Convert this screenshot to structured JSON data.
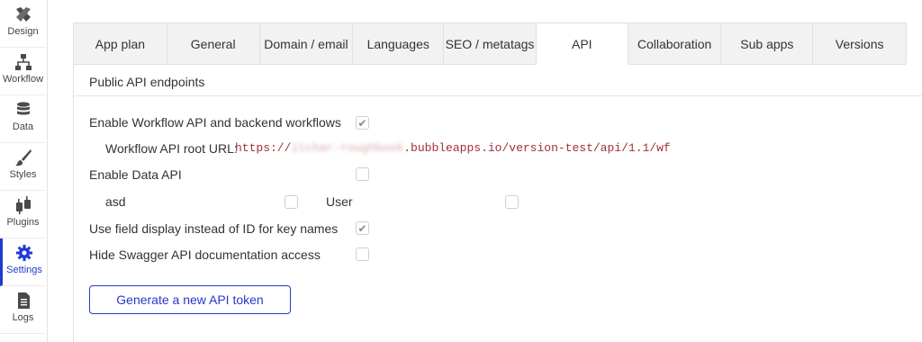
{
  "sidebar": {
    "items": [
      {
        "label": "Design",
        "icon": "design-icon"
      },
      {
        "label": "Workflow",
        "icon": "workflow-icon"
      },
      {
        "label": "Data",
        "icon": "data-icon"
      },
      {
        "label": "Styles",
        "icon": "styles-icon"
      },
      {
        "label": "Plugins",
        "icon": "plugins-icon"
      },
      {
        "label": "Settings",
        "icon": "gear-icon",
        "active": true
      },
      {
        "label": "Logs",
        "icon": "logs-icon"
      }
    ]
  },
  "tabs": [
    {
      "label": "App plan"
    },
    {
      "label": "General"
    },
    {
      "label": "Domain / email"
    },
    {
      "label": "Languages"
    },
    {
      "label": "SEO / metatags"
    },
    {
      "label": "API",
      "active": true
    },
    {
      "label": "Collaboration"
    },
    {
      "label": "Sub apps"
    },
    {
      "label": "Versions"
    }
  ],
  "section": {
    "title": "Public API endpoints"
  },
  "settings": {
    "workflow_api": {
      "label": "Enable Workflow API and backend workflows",
      "checked": true
    },
    "root_url": {
      "label": "Workflow API root URL:",
      "prefix": "https://",
      "hidden": "itchar-roughbook",
      "suffix": ".bubbleapps.io/version-test/api/1.1/wf"
    },
    "data_api": {
      "label": "Enable Data API",
      "checked": false
    },
    "data_types": [
      {
        "label": "asd",
        "checked": false
      },
      {
        "label": "User",
        "checked": false
      }
    ],
    "field_display": {
      "label": "Use field display instead of ID for key names",
      "checked": true
    },
    "hide_swagger": {
      "label": "Hide Swagger API documentation access",
      "checked": false
    }
  },
  "actions": {
    "generate_token": "Generate a new API token"
  },
  "colors": {
    "accent": "#1f3bd1",
    "url_text": "#a0303a",
    "tab_bg": "#f2f2f2"
  }
}
